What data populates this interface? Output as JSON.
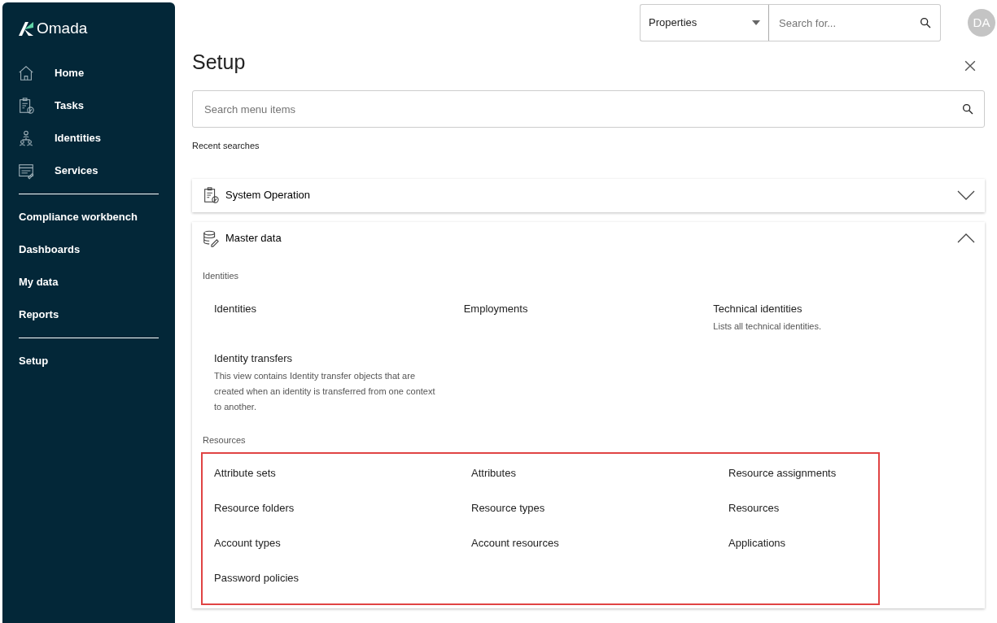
{
  "sidebar": {
    "logo": "Omada",
    "primary_items": [
      {
        "label": "Home"
      },
      {
        "label": "Tasks"
      },
      {
        "label": "Identities"
      },
      {
        "label": "Services"
      }
    ],
    "secondary_items": [
      {
        "label": "Compliance workbench"
      },
      {
        "label": "Dashboards"
      },
      {
        "label": "My data"
      },
      {
        "label": "Reports"
      }
    ],
    "footer_items": [
      {
        "label": "Setup"
      }
    ]
  },
  "topbar": {
    "scope_select": "Properties",
    "search": {
      "placeholder": "Search for..."
    },
    "avatar": "DA"
  },
  "page": {
    "title": "Setup",
    "menu_search": {
      "placeholder": "Search menu items"
    },
    "recent_searches": "Recent searches",
    "sections": [
      {
        "title": "System Operation",
        "expanded": false
      },
      {
        "title": "Master data",
        "expanded": true,
        "groups": [
          {
            "label": "Identities",
            "highlighted": false,
            "items": [
              {
                "title": "Identities"
              },
              {
                "title": "Employments"
              },
              {
                "title": "Technical identities",
                "description": "Lists all technical identities."
              },
              {
                "title": "Identity transfers",
                "description": "This view contains Identity transfer objects that are created when an identity is transferred from one context to another."
              }
            ]
          },
          {
            "label": "Resources",
            "highlighted": true,
            "items": [
              {
                "title": "Attribute sets"
              },
              {
                "title": "Attributes"
              },
              {
                "title": "Resource assignments"
              },
              {
                "title": "Resource folders"
              },
              {
                "title": "Resource types"
              },
              {
                "title": "Resources"
              },
              {
                "title": "Account types"
              },
              {
                "title": "Account resources"
              },
              {
                "title": "Applications"
              },
              {
                "title": "Password policies"
              }
            ]
          }
        ]
      }
    ]
  }
}
